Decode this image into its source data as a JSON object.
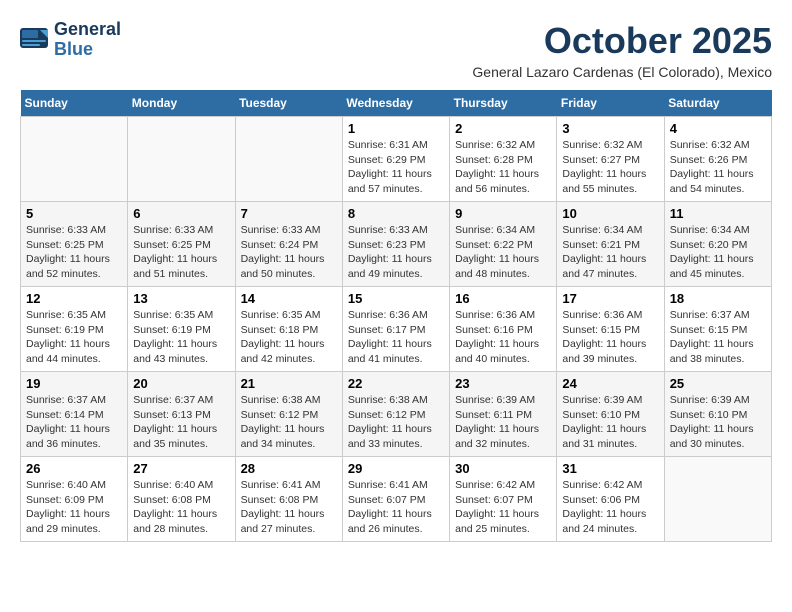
{
  "header": {
    "logo_line1": "General",
    "logo_line2": "Blue",
    "title": "October 2025",
    "subtitle": "General Lazaro Cardenas (El Colorado), Mexico"
  },
  "weekdays": [
    "Sunday",
    "Monday",
    "Tuesday",
    "Wednesday",
    "Thursday",
    "Friday",
    "Saturday"
  ],
  "weeks": [
    [
      {
        "day": "",
        "info": ""
      },
      {
        "day": "",
        "info": ""
      },
      {
        "day": "",
        "info": ""
      },
      {
        "day": "1",
        "info": "Sunrise: 6:31 AM\nSunset: 6:29 PM\nDaylight: 11 hours\nand 57 minutes."
      },
      {
        "day": "2",
        "info": "Sunrise: 6:32 AM\nSunset: 6:28 PM\nDaylight: 11 hours\nand 56 minutes."
      },
      {
        "day": "3",
        "info": "Sunrise: 6:32 AM\nSunset: 6:27 PM\nDaylight: 11 hours\nand 55 minutes."
      },
      {
        "day": "4",
        "info": "Sunrise: 6:32 AM\nSunset: 6:26 PM\nDaylight: 11 hours\nand 54 minutes."
      }
    ],
    [
      {
        "day": "5",
        "info": "Sunrise: 6:33 AM\nSunset: 6:25 PM\nDaylight: 11 hours\nand 52 minutes."
      },
      {
        "day": "6",
        "info": "Sunrise: 6:33 AM\nSunset: 6:25 PM\nDaylight: 11 hours\nand 51 minutes."
      },
      {
        "day": "7",
        "info": "Sunrise: 6:33 AM\nSunset: 6:24 PM\nDaylight: 11 hours\nand 50 minutes."
      },
      {
        "day": "8",
        "info": "Sunrise: 6:33 AM\nSunset: 6:23 PM\nDaylight: 11 hours\nand 49 minutes."
      },
      {
        "day": "9",
        "info": "Sunrise: 6:34 AM\nSunset: 6:22 PM\nDaylight: 11 hours\nand 48 minutes."
      },
      {
        "day": "10",
        "info": "Sunrise: 6:34 AM\nSunset: 6:21 PM\nDaylight: 11 hours\nand 47 minutes."
      },
      {
        "day": "11",
        "info": "Sunrise: 6:34 AM\nSunset: 6:20 PM\nDaylight: 11 hours\nand 45 minutes."
      }
    ],
    [
      {
        "day": "12",
        "info": "Sunrise: 6:35 AM\nSunset: 6:19 PM\nDaylight: 11 hours\nand 44 minutes."
      },
      {
        "day": "13",
        "info": "Sunrise: 6:35 AM\nSunset: 6:19 PM\nDaylight: 11 hours\nand 43 minutes."
      },
      {
        "day": "14",
        "info": "Sunrise: 6:35 AM\nSunset: 6:18 PM\nDaylight: 11 hours\nand 42 minutes."
      },
      {
        "day": "15",
        "info": "Sunrise: 6:36 AM\nSunset: 6:17 PM\nDaylight: 11 hours\nand 41 minutes."
      },
      {
        "day": "16",
        "info": "Sunrise: 6:36 AM\nSunset: 6:16 PM\nDaylight: 11 hours\nand 40 minutes."
      },
      {
        "day": "17",
        "info": "Sunrise: 6:36 AM\nSunset: 6:15 PM\nDaylight: 11 hours\nand 39 minutes."
      },
      {
        "day": "18",
        "info": "Sunrise: 6:37 AM\nSunset: 6:15 PM\nDaylight: 11 hours\nand 38 minutes."
      }
    ],
    [
      {
        "day": "19",
        "info": "Sunrise: 6:37 AM\nSunset: 6:14 PM\nDaylight: 11 hours\nand 36 minutes."
      },
      {
        "day": "20",
        "info": "Sunrise: 6:37 AM\nSunset: 6:13 PM\nDaylight: 11 hours\nand 35 minutes."
      },
      {
        "day": "21",
        "info": "Sunrise: 6:38 AM\nSunset: 6:12 PM\nDaylight: 11 hours\nand 34 minutes."
      },
      {
        "day": "22",
        "info": "Sunrise: 6:38 AM\nSunset: 6:12 PM\nDaylight: 11 hours\nand 33 minutes."
      },
      {
        "day": "23",
        "info": "Sunrise: 6:39 AM\nSunset: 6:11 PM\nDaylight: 11 hours\nand 32 minutes."
      },
      {
        "day": "24",
        "info": "Sunrise: 6:39 AM\nSunset: 6:10 PM\nDaylight: 11 hours\nand 31 minutes."
      },
      {
        "day": "25",
        "info": "Sunrise: 6:39 AM\nSunset: 6:10 PM\nDaylight: 11 hours\nand 30 minutes."
      }
    ],
    [
      {
        "day": "26",
        "info": "Sunrise: 6:40 AM\nSunset: 6:09 PM\nDaylight: 11 hours\nand 29 minutes."
      },
      {
        "day": "27",
        "info": "Sunrise: 6:40 AM\nSunset: 6:08 PM\nDaylight: 11 hours\nand 28 minutes."
      },
      {
        "day": "28",
        "info": "Sunrise: 6:41 AM\nSunset: 6:08 PM\nDaylight: 11 hours\nand 27 minutes."
      },
      {
        "day": "29",
        "info": "Sunrise: 6:41 AM\nSunset: 6:07 PM\nDaylight: 11 hours\nand 26 minutes."
      },
      {
        "day": "30",
        "info": "Sunrise: 6:42 AM\nSunset: 6:07 PM\nDaylight: 11 hours\nand 25 minutes."
      },
      {
        "day": "31",
        "info": "Sunrise: 6:42 AM\nSunset: 6:06 PM\nDaylight: 11 hours\nand 24 minutes."
      },
      {
        "day": "",
        "info": ""
      }
    ]
  ]
}
